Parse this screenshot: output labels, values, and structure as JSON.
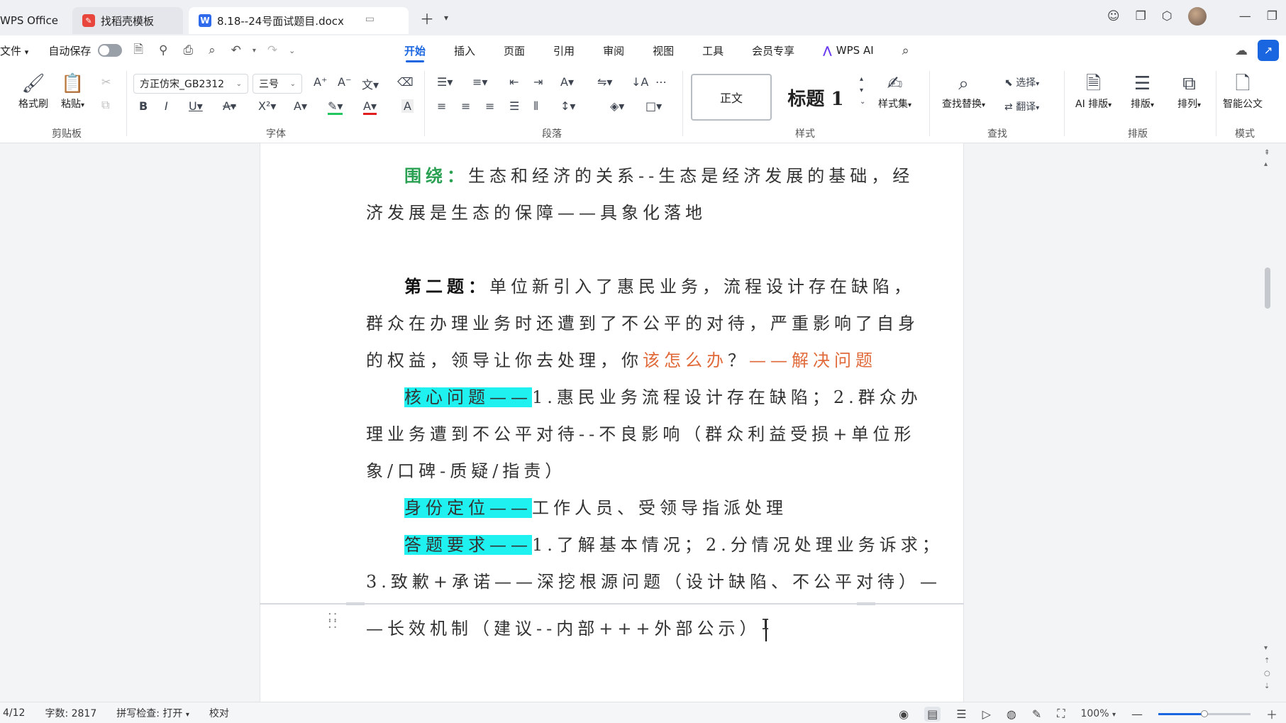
{
  "window": {
    "app_tab": "WPS Office",
    "template_tab": "找稻壳模板",
    "doc_tab": "8.18--24号面试题目.docx",
    "doc_tab_icon": "W"
  },
  "menu": {
    "file": "文件",
    "autosave": "自动保存",
    "items": [
      "开始",
      "插入",
      "页面",
      "引用",
      "审阅",
      "视图",
      "工具",
      "会员专享"
    ],
    "active_index": 0,
    "wps_ai": "WPS AI"
  },
  "ribbon": {
    "clipboard": {
      "format_painter": "格式刷",
      "paste": "粘贴",
      "group": "剪贴板"
    },
    "font": {
      "family": "方正仿宋_GB2312",
      "size": "三号",
      "group": "字体"
    },
    "paragraph": {
      "group": "段落"
    },
    "styles": {
      "normal": "正文",
      "heading": "标题 1",
      "style_set": "样式集",
      "group": "样式"
    },
    "find": {
      "find_replace": "查找替换",
      "select": "选择",
      "translate": "翻译",
      "group": "查找"
    },
    "layout": {
      "ai_layout": "AI 排版",
      "layout": "排版",
      "arrange": "排列",
      "group": "排版"
    },
    "mode": {
      "smart_doc": "智能公文",
      "group": "模式"
    }
  },
  "document": {
    "lines": [
      {
        "label": "围绕：",
        "text": "生态和经济的关系--生态是经济发展的基础，经"
      },
      {
        "text": "济发展是生态的保障——具象化落地"
      },
      {
        "label": "第二题：",
        "text": "单位新引入了惠民业务，流程设计存在缺陷，"
      },
      {
        "text": "群众在办理业务时还遭到了不公平的对待，严重影响了自身"
      },
      {
        "text": "的权益，领导让你去处理，你",
        "orange": "该怎么办",
        "text2": "？",
        "orange2": "——解决问题"
      },
      {
        "highlight": "核心问题——",
        "text": "1.惠民业务流程设计存在缺陷；2.群众办"
      },
      {
        "text": "理业务遭到不公平对待--不良影响（群众利益受损+单位形"
      },
      {
        "text": "象/口碑-质疑/指责）"
      },
      {
        "highlight": "身份定位——",
        "text": "工作人员、受领导指派处理"
      },
      {
        "highlight": "答题要求——",
        "text": "1.了解基本情况；2.分情况处理业务诉求；"
      },
      {
        "text": "3.致歉+承诺——深挖根源问题（设计缺陷、不公平对待）—"
      },
      {
        "text": "—长效机制（建议--内部+++外部公示）"
      }
    ]
  },
  "status": {
    "page": "4/12",
    "word_count": "字数: 2817",
    "spell_check": "拼写检查: 打开",
    "proofread": "校对",
    "zoom": "100%",
    "zoom_level_fraction": 0.5
  },
  "colors": {
    "accent": "#1a66e0",
    "highlight": "#1ff0f0",
    "green_label": "#2aa052",
    "orange_text": "#e06a3a"
  }
}
